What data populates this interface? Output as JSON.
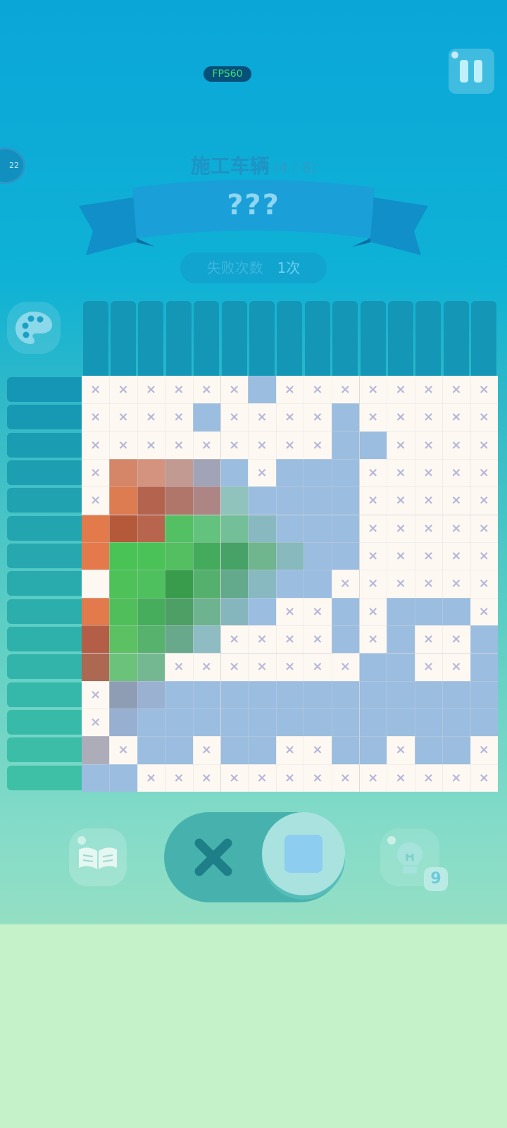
{
  "hud": {
    "fps_label": "FPS60",
    "timer_text": "22",
    "puzzle_title": "施工车辆",
    "puzzle_progress": "(4 / 8)",
    "puzzle_name": "???",
    "fail_label": "失败次数",
    "fail_count": "1次",
    "hint_count": "9"
  },
  "icons": {
    "pause": "pause-icon",
    "palette": "palette-icon",
    "book": "book-icon",
    "cross_mode": "cross-mode-icon",
    "fill_mode": "fill-mode-icon",
    "hint": "lightbulb-icon"
  },
  "colors": {
    "cross_mark": "#b6b5d9",
    "empty_cell": "#fdf9f2",
    "blue_fill": "#9bbde0"
  },
  "grid": {
    "rows": 15,
    "cols": 15,
    "cells": [
      "x,x,x,x,x,x,#9bbde0,x,x,x,x,x,x,x,x",
      "x,x,x,x,#9bbde0,x,x,x,x,#9bbde0,x,x,x,x,x",
      "x,x,x,x,x,x,x,x,x,#9bbde0,#9bbde0,x,x,x,x",
      "x,#d58669,#d4937e,#c29a92,#a0a4b6,#9bbde0,x,#9bbde0,#9bbde0,#9bbde0,x,x,x,x,x",
      "x,#de7c51,#b4644e,#b1766a,#ad8585,#8fc3bc,#9bbde0,#9bbde0,#9bbde0,#9bbde0,x,x,x,x,x",
      "#e27a4c,#b5593b,#b8654d,#54c064,#62c27e,#73c098,#89b9c0,#9bbde0,#9bbde0,#9bbde0,x,x,x,x,x",
      "#e47a4c,#49c356,#4ac257,#53bf61,#44ab5c,#46a266,#6fb58e,#87b9bd,#9bbde0,#9bbde0,x,x,x,x,x",
      "#fdf9f2,#4ec158,#4fc05e,#399c4c,#55b06d,#63a98b,#89b9c0,#9bbde0,#9bbde0,x,x,x,x,x,x",
      "#e27a4c,#50bf5b,#46ad5d,#4d9f65,#6db38f,#86b6bd,#9bbde0,x,x,#9bbde0,x,#9bbde0,#9bbde0,#9bbde0,x",
      "#b55e47,#5bc163,#56b26d,#67a98a,#8ebcc2,x,x,x,x,#9bbde0,x,#9bbde0,x,x,#9bbde0",
      "#ad6852,#6bc27b,#73b891,x,x,x,x,x,x,x,#9bbde0,#9bbde0,x,x,#9bbde0",
      "x,#8f9db4,#9ab1d2,#9bbde0,#9bbde0,#9bbde0,#9bbde0,#9bbde0,#9bbde0,#9bbde0,#9bbde0,#9bbde0,#9bbde0,#9bbde0,#9bbde0",
      "x,#97b0d2,#9bbde0,#9bbde0,#9bbde0,#9bbde0,#9bbde0,#9bbde0,#9bbde0,#9bbde0,#9bbde0,#9bbde0,#9bbde0,#9bbde0,#9bbde0",
      "#adadba,x,#9bbde0,#9bbde0,x,#9bbde0,#9bbde0,x,x,#9bbde0,#9bbde0,x,#9bbde0,#9bbde0,x",
      "#9bbde0,#9bbde0,x,x,x,x,x,x,x,x,x,x,x,x,x"
    ]
  }
}
